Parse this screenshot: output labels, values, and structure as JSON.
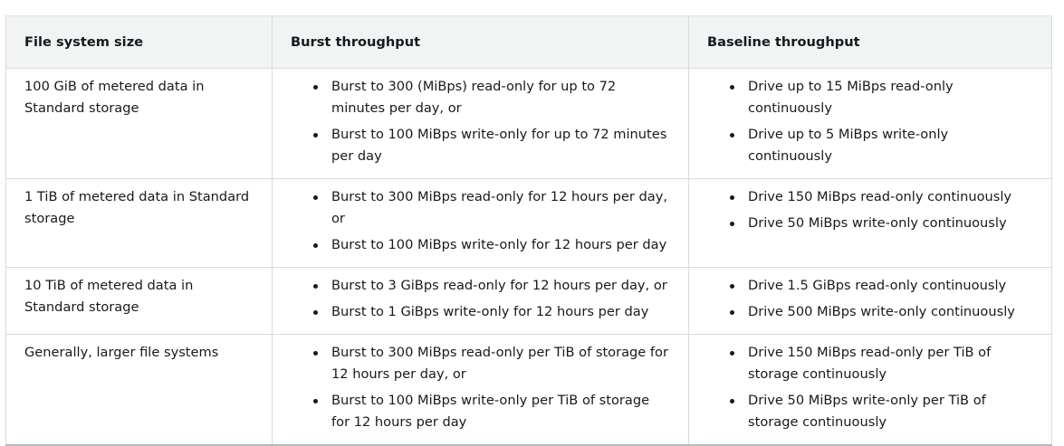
{
  "table": {
    "headers": [
      "File system size",
      "Burst throughput",
      "Baseline throughput"
    ],
    "rows": [
      {
        "size": "100 GiB of metered data in Standard storage",
        "burst": [
          "Burst to 300 (MiBps) read-only for up to 72 minutes per day, or",
          "Burst to 100 MiBps write-only for up to 72 minutes per day"
        ],
        "baseline": [
          "Drive up to 15 MiBps read-only continuously",
          "Drive up to 5 MiBps write-only continuously"
        ]
      },
      {
        "size": "1 TiB of metered data in Standard storage",
        "burst": [
          "Burst to 300 MiBps read-only for 12 hours per day, or",
          "Burst to 100 MiBps write-only for 12 hours per day"
        ],
        "baseline": [
          "Drive 150 MiBps read-only continuously",
          "Drive 50 MiBps write-only continuously"
        ]
      },
      {
        "size": "10 TiB of metered data in Standard storage",
        "burst": [
          "Burst to 3 GiBps read-only for 12 hours per day, or",
          "Burst to 1 GiBps write-only for 12 hours per day"
        ],
        "baseline": [
          "Drive 1.5 GiBps read-only continuously",
          "Drive 500 MiBps write-only continuously"
        ]
      },
      {
        "size": "Generally, larger file systems",
        "burst": [
          "Burst to 300 MiBps read-only per TiB of storage for 12 hours per day, or",
          "Burst to 100 MiBps write-only per TiB of storage for 12 hours per day"
        ],
        "baseline": [
          "Drive 150 MiBps read-only per TiB of storage continuously",
          "Drive 50 MiBps write-only per TiB of storage continuously"
        ]
      }
    ]
  }
}
